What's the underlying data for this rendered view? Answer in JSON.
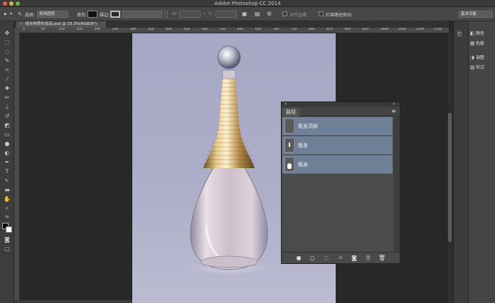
{
  "window": {
    "title": "Adobe Photoshop CC 2014"
  },
  "options_bar": {
    "select_label": "选择:",
    "select_value": "现用图层",
    "fill_label": "填充:",
    "stroke_label": "描边:",
    "w_label": "W:",
    "h_label": "H:",
    "align_edges": "对齐边缘",
    "constrain_path": "约束路径拖动",
    "workspace": "基本功能"
  },
  "document": {
    "tab_label": "组合材质化妆品.psd @ 33.3%(RGB/8*)",
    "tab_close": "×"
  },
  "ruler": {
    "top_ticks": [
      "0",
      "50",
      "100",
      "150",
      "200",
      "250",
      "300",
      "350",
      "400",
      "450",
      "500",
      "550",
      "600",
      "650",
      "700",
      "750",
      "800",
      "850",
      "900",
      "950",
      "1000",
      "1050",
      "1100",
      "1150"
    ]
  },
  "dock": {
    "items": [
      {
        "icon": "color-icon",
        "label": "颜色"
      },
      {
        "icon": "swatches-icon",
        "label": "色板"
      },
      {
        "icon": "adjustments-icon",
        "label": "调整"
      },
      {
        "icon": "styles-icon",
        "label": "样式"
      }
    ]
  },
  "paths_panel": {
    "tab": "路径",
    "menu_icon": "panel-menu-icon",
    "paths": [
      {
        "name": "瓶盖顶部"
      },
      {
        "name": "瓶盖"
      },
      {
        "name": "瓶身"
      }
    ],
    "footer_icons": [
      "fill-path-icon",
      "stroke-path-icon",
      "load-selection-icon",
      "make-work-path-icon",
      "add-mask-icon",
      "new-path-icon",
      "delete-path-icon"
    ]
  },
  "colors": {
    "selected_row": "#6f7f95",
    "background_photo": "#a9aac6"
  }
}
